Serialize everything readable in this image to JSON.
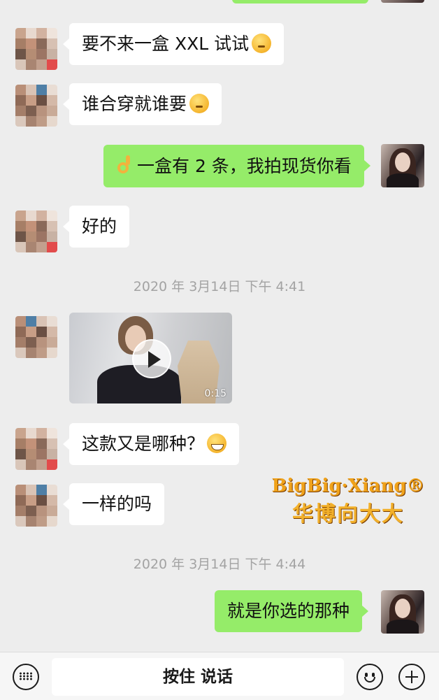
{
  "colors": {
    "background": "#ededed",
    "incoming_bubble": "#ffffff",
    "outgoing_bubble": "#95ec69",
    "timestamp_text": "#a3a3a3"
  },
  "messages": [
    {
      "side": "left",
      "text": "要不来一盒 XXL 试试",
      "emoji": "thinking-face"
    },
    {
      "side": "left",
      "text": "谁合穿就谁要",
      "emoji": "thinking-face"
    },
    {
      "side": "right",
      "emoji_lead": "ok-hand",
      "text": "一盒有 2 条，我拍现货你看"
    },
    {
      "side": "left",
      "text": "好的"
    },
    {
      "timestamp": "2020 年 3月14日 下午 4:41"
    },
    {
      "side": "left",
      "type": "video",
      "duration": "0:15"
    },
    {
      "side": "left",
      "text": "这款又是哪种？",
      "emoji": "grinning-face"
    },
    {
      "side": "left",
      "text": "一样的吗"
    },
    {
      "timestamp": "2020 年 3月14日 下午 4:44"
    },
    {
      "side": "right",
      "text": "就是你选的那种"
    }
  ],
  "watermark": {
    "english": "BigBig·Xiang®",
    "chinese": "华博向大大"
  },
  "input_bar": {
    "hold_to_talk": "按住 说话",
    "icons": [
      "keyboard-icon",
      "emoji-icon",
      "plus-icon"
    ]
  }
}
